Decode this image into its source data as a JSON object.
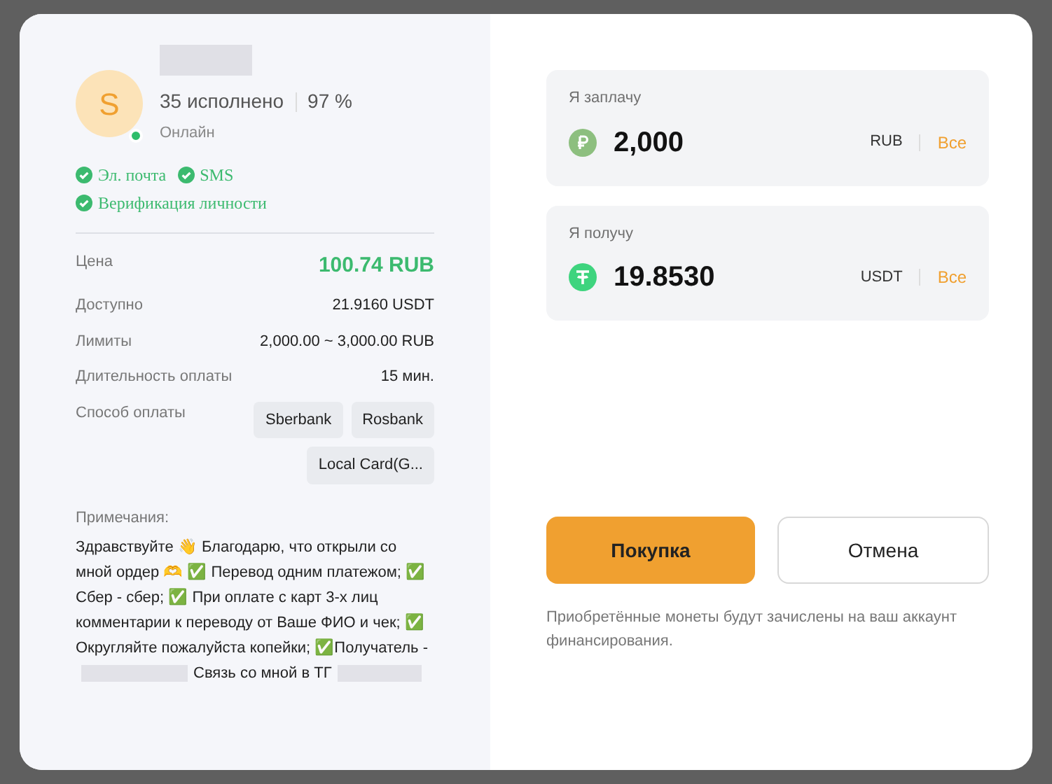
{
  "seller": {
    "avatar_letter": "S",
    "online": true,
    "completed": "35 исполнено",
    "rate": "97 %",
    "status": "Онлайн"
  },
  "verifications": [
    {
      "label": "Эл. почта",
      "verified": true
    },
    {
      "label": "SMS",
      "verified": true
    },
    {
      "label": "Верификация личности",
      "verified": true
    }
  ],
  "details": [
    {
      "label": "Цена",
      "value": "100.74 RUB",
      "kind": "price"
    },
    {
      "label": "Доступно",
      "value": "21.9160 USDT",
      "kind": "plain"
    },
    {
      "label": "Лимиты",
      "value": "2,000.00 ~ 3,000.00 RUB",
      "kind": "plain"
    },
    {
      "label": "Длительность оплаты",
      "value": "15 мин.",
      "kind": "plain"
    }
  ],
  "payment_methods": {
    "label": "Способ оплаты",
    "items": [
      "Sberbank",
      "Rosbank",
      "Local Card(G..."
    ]
  },
  "notes": {
    "label": "Примечания:",
    "parts": [
      "Здравствуйте 👋 Благодарю, что открыли со мной ордер 🫶 ✅ Перевод одним платежом; ✅ Сбер - сбер; ✅ При оплате с карт 3-х лиц комментарии к переводу от Ваше ФИО и чек; ✅ Округляйте пожалуйста копейки; ✅Получатель -",
      "Связь со мной в ТГ"
    ]
  },
  "pay": {
    "label": "Я заплачу",
    "amount": "2,000",
    "currency": "RUB",
    "max": "Все",
    "kind": "rub"
  },
  "receive": {
    "label": "Я получу",
    "amount": "19.8530",
    "currency": "USDT",
    "max": "Все",
    "kind": "usdt"
  },
  "buttons": {
    "buy": "Покупка",
    "cancel": "Отмена"
  },
  "footnote": "Приобретённые монеты будут зачислены на ваш аккаунт финансирования."
}
